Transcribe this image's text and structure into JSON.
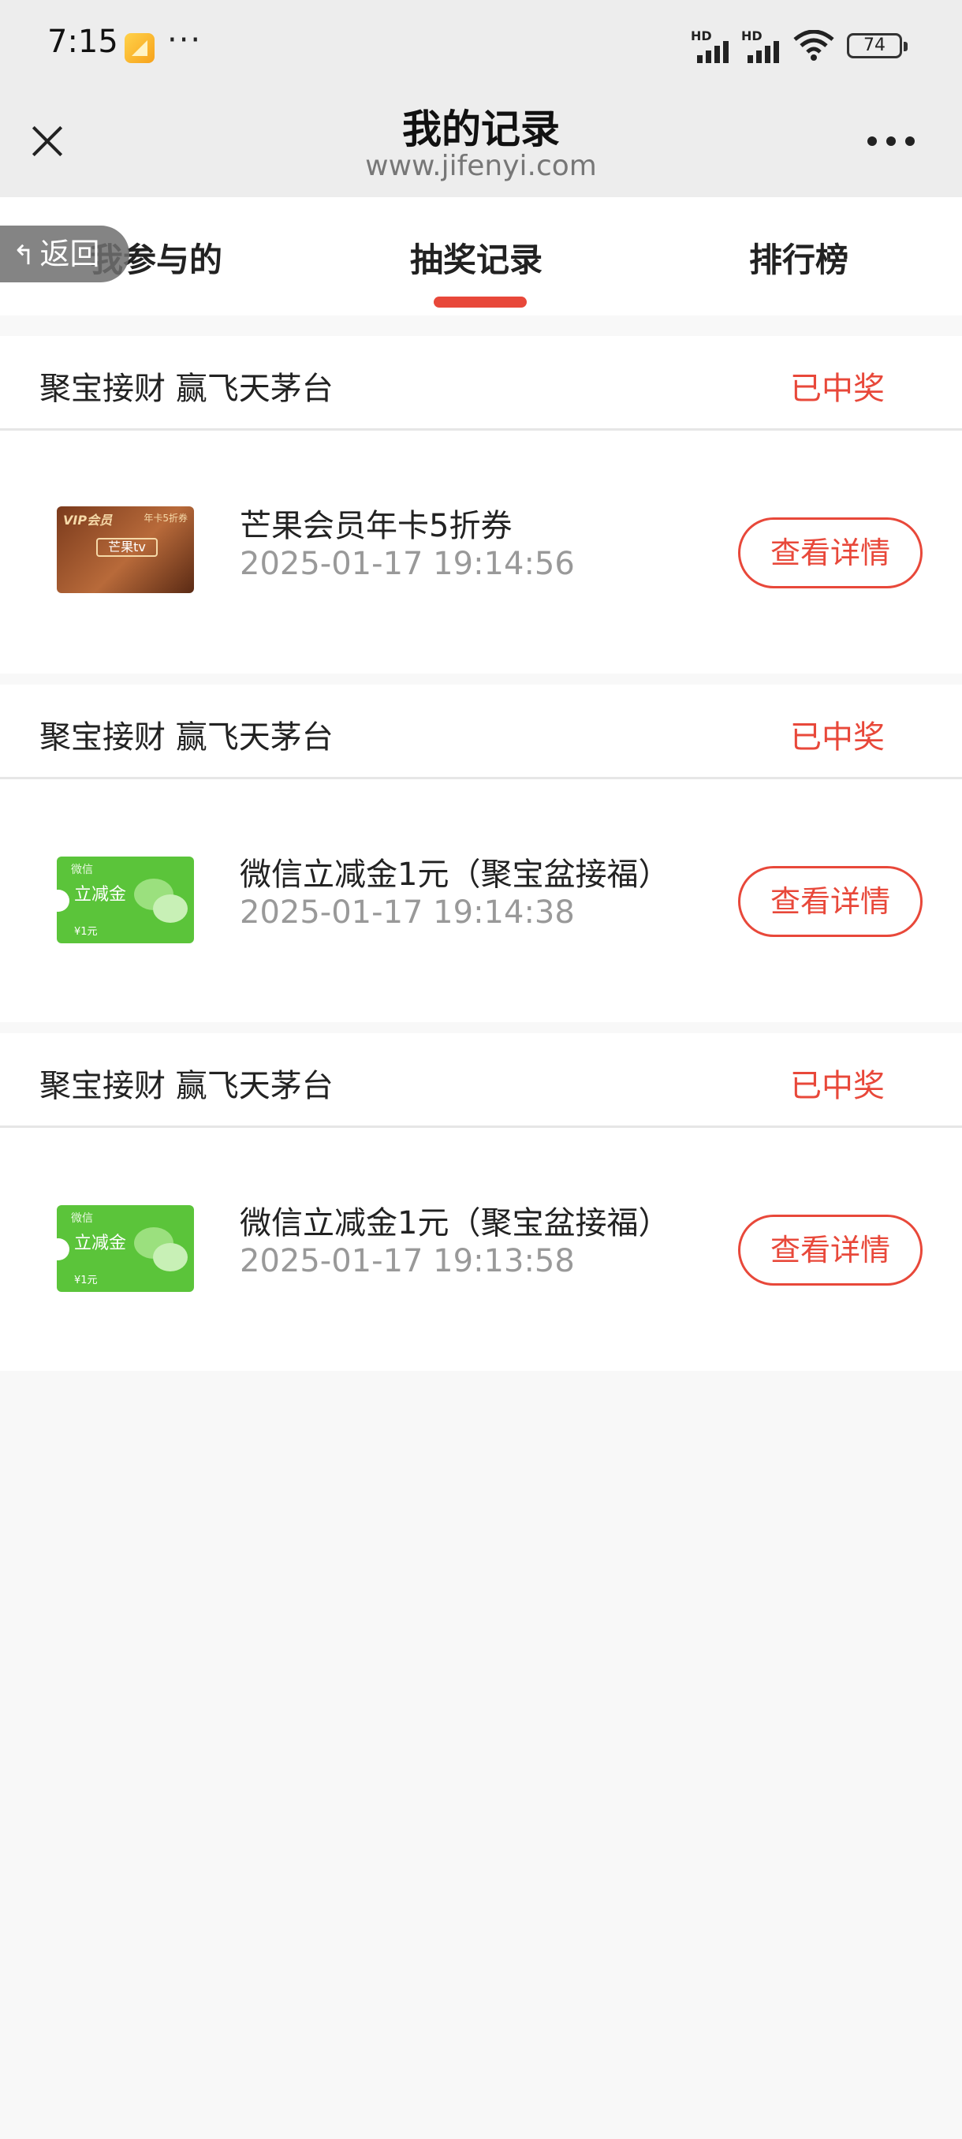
{
  "status_bar": {
    "time": "7:15",
    "dots": "···",
    "hd_label": "HD",
    "battery": "74"
  },
  "nav": {
    "title": "我的记录",
    "url": "www.jifenyi.com"
  },
  "back": {
    "label": "返回"
  },
  "tabs": [
    {
      "label": "我参与的"
    },
    {
      "label": "抽奖记录",
      "active": true
    },
    {
      "label": "排行榜"
    }
  ],
  "colors": {
    "accent": "#e8483a",
    "page_bg": "#f8f8f8",
    "bar_bg": "#ededed"
  },
  "records": [
    {
      "activity": "聚宝接财 赢飞天茅台",
      "status": "已中奖",
      "prize_name": "芒果会员年卡5折券",
      "time": "2025-01-17 19:14:56",
      "thumb": {
        "type": "mango-tv-card",
        "vip": "VIP会员",
        "tag": "年卡5折券",
        "logo": "芒果tv"
      },
      "detail_label": "查看详情"
    },
    {
      "activity": "聚宝接财 赢飞天茅台",
      "status": "已中奖",
      "prize_name": "微信立减金1元（聚宝盆接福）",
      "time": "2025-01-17 19:14:38",
      "thumb": {
        "type": "wechat-coupon",
        "brand": "微信",
        "title": "立减金",
        "amount": "¥1元"
      },
      "detail_label": "查看详情"
    },
    {
      "activity": "聚宝接财 赢飞天茅台",
      "status": "已中奖",
      "prize_name": "微信立减金1元（聚宝盆接福）",
      "time": "2025-01-17 19:13:58",
      "thumb": {
        "type": "wechat-coupon",
        "brand": "微信",
        "title": "立减金",
        "amount": "¥1元"
      },
      "detail_label": "查看详情"
    }
  ]
}
